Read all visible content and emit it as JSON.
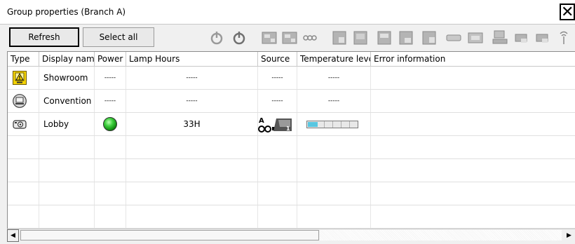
{
  "window": {
    "title": "Group properties (Branch A)",
    "close_glyph": "✕"
  },
  "toolbar": {
    "refresh_label": "Refresh",
    "select_all_label": "Select all",
    "tools": [
      "power-on-icon",
      "power-off-icon",
      "computer1-input-icon",
      "computer2-input-icon",
      "video-input-icon",
      "svideo-input-icon",
      "component-input-icon",
      "hdmi-input-icon",
      "lan-input-icon",
      "usb-input-icon",
      "usb-display-icon",
      "av-mute-icon",
      "mp-icon",
      "network-icon",
      "input1-icon",
      "input2-icon",
      "wireless-icon"
    ]
  },
  "table": {
    "columns": [
      "Type",
      "Display name",
      "Power",
      "Lamp Hours",
      "Source",
      "Temperature level",
      "Error information"
    ],
    "rows": [
      {
        "type_icon": "warning-icon",
        "display_name": "Showroom",
        "power": "-----",
        "lamp_hours": "-----",
        "source": "-----",
        "temperature": "-----",
        "error": ""
      },
      {
        "type_icon": "monitor-icon",
        "display_name": "Convention Hall",
        "power": "-----",
        "lamp_hours": "-----",
        "source": "-----",
        "temperature": "-----",
        "error": ""
      },
      {
        "type_icon": "projector-icon",
        "display_name": "Lobby",
        "power": "on",
        "lamp_hours": "33H",
        "source": "computer1-source-icon",
        "temperature_level": 0.2,
        "error": ""
      }
    ]
  },
  "colors": {
    "power_on": "#3ecf3e",
    "temperature_fill": "#58c6e0",
    "warning": "#f5d400"
  }
}
